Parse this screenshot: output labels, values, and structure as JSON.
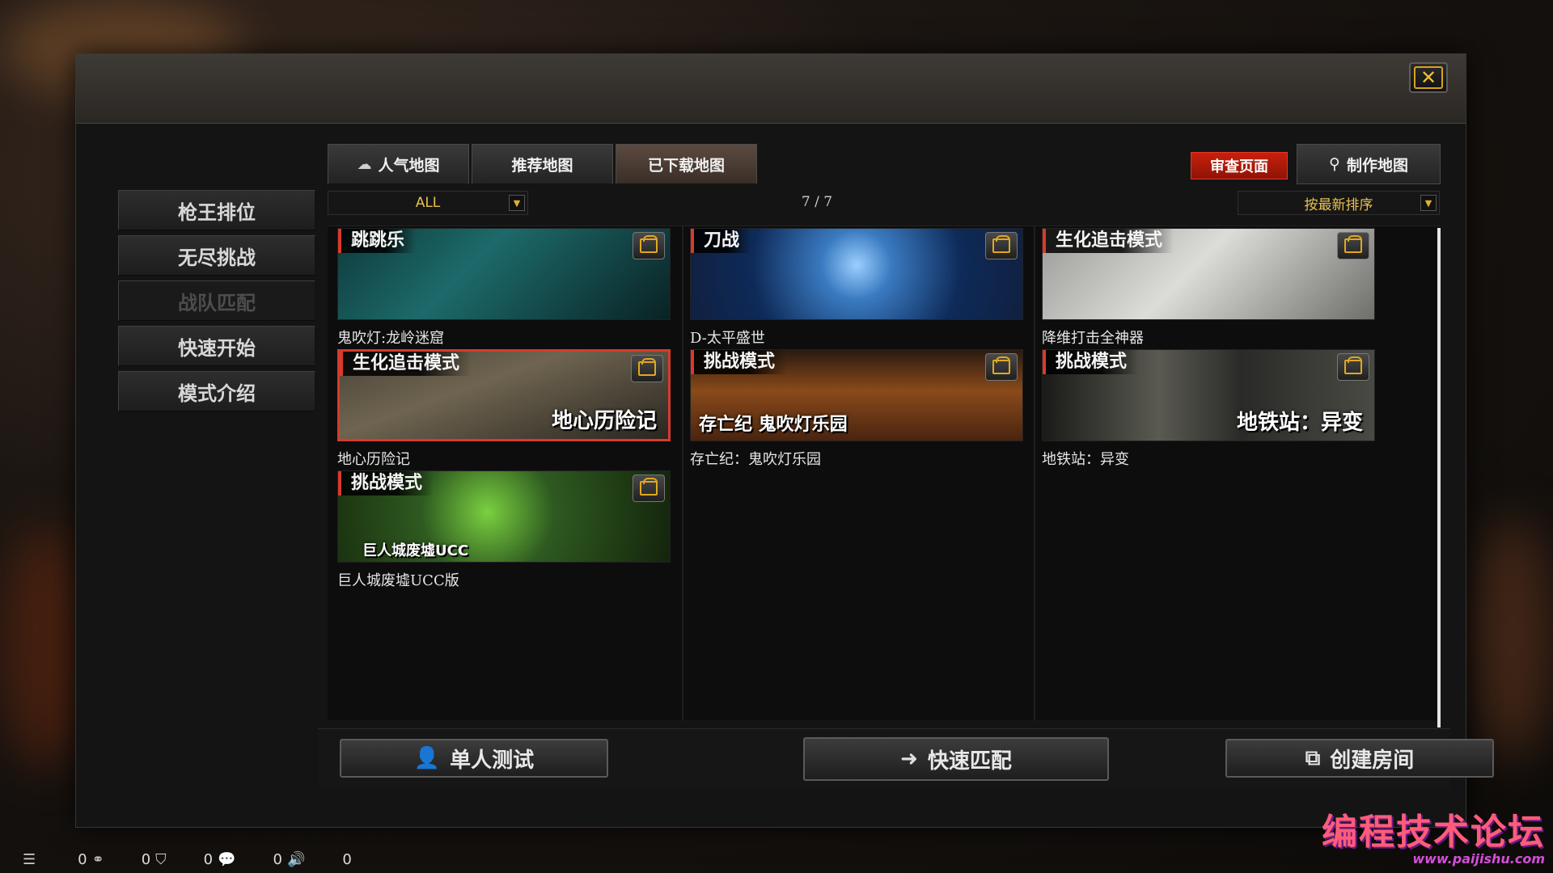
{
  "dialog": {
    "close_label": "✕"
  },
  "side_menu": [
    {
      "label": "枪王排位",
      "enabled": true
    },
    {
      "label": "无尽挑战",
      "enabled": true
    },
    {
      "label": "战队匹配",
      "enabled": false
    },
    {
      "label": "快速开始",
      "enabled": true
    },
    {
      "label": "模式介绍",
      "enabled": true
    }
  ],
  "tabs": [
    {
      "label": "人气地图",
      "icon": "popular-icon"
    },
    {
      "label": "推荐地图"
    },
    {
      "label": "已下载地图",
      "active": true
    }
  ],
  "toolbar": {
    "review_label": "审查页面",
    "make_map_label": "制作地图",
    "filter_value": "ALL",
    "sort_value": "按最新排序",
    "pager": "7 / 7"
  },
  "maps": [
    {
      "name": "鬼吹灯:龙岭迷窟",
      "tag": "跳跳乐",
      "overlay": "",
      "selected": false
    },
    {
      "name": "D-太平盛世",
      "tag": "刀战",
      "overlay": "",
      "selected": false
    },
    {
      "name": "降维打击全神器",
      "tag": "生化追击模式",
      "overlay": "",
      "selected": false
    },
    {
      "name": "地心历险记",
      "tag": "生化追击模式",
      "overlay": "地心历险记",
      "selected": true
    },
    {
      "name": "存亡纪：鬼吹灯乐园",
      "tag": "挑战模式",
      "overlay": "存亡纪 鬼吹灯乐园",
      "selected": false
    },
    {
      "name": "地铁站：异变",
      "tag": "挑战模式",
      "overlay": "地铁站：异变",
      "selected": false
    },
    {
      "name": "巨人城废墟UCC版",
      "tag": "挑战模式",
      "overlay": "巨人城废墟UCC",
      "selected": false
    }
  ],
  "bottom": {
    "solo_test": "单人测试",
    "quick_match": "快速匹配",
    "create_room": "创建房间"
  },
  "status": {
    "counts": [
      "0",
      "0",
      "0",
      "0",
      "0"
    ]
  },
  "watermark": {
    "title": "编程技术论坛",
    "url": "www.paijishu.com"
  }
}
